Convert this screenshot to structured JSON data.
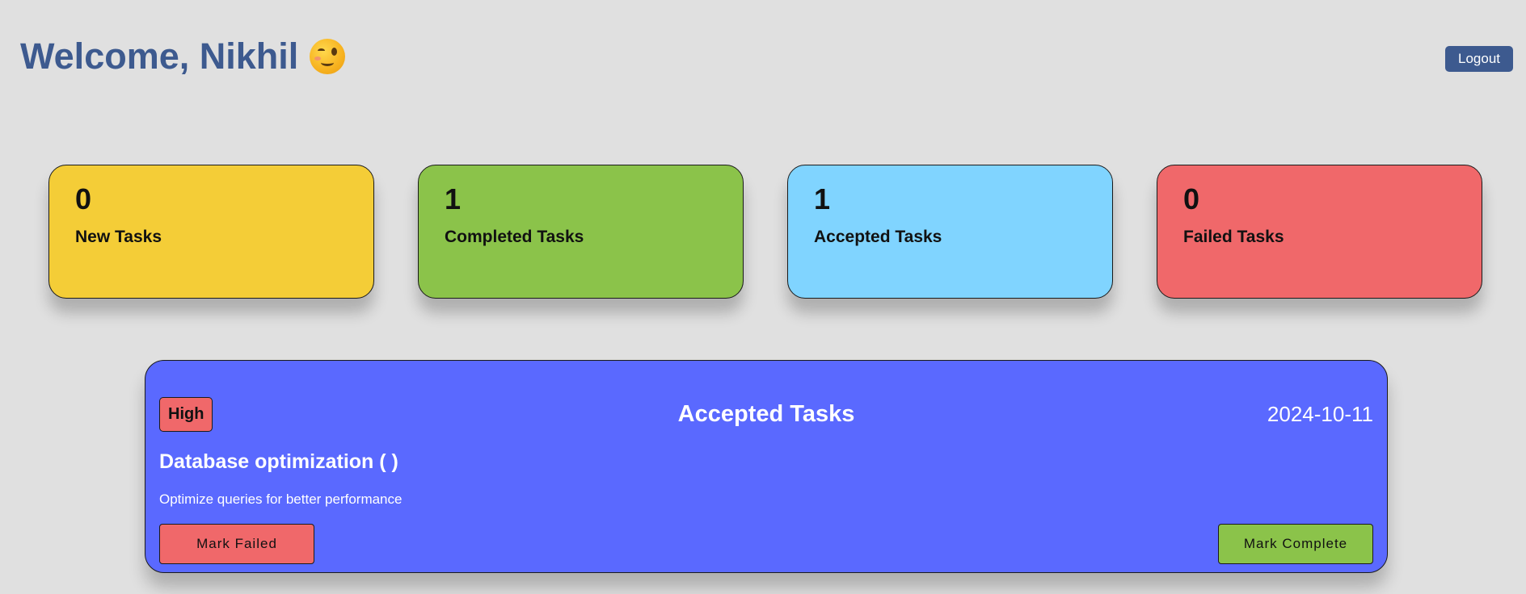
{
  "header": {
    "welcome_text": "Welcome, Nikhil",
    "emoji_icon": "winking-face-icon",
    "logout_label": "Logout"
  },
  "stats": [
    {
      "count": "0",
      "label": "New Tasks",
      "color": "#f4cd37"
    },
    {
      "count": "1",
      "label": "Completed Tasks",
      "color": "#8bc34a"
    },
    {
      "count": "1",
      "label": "Accepted Tasks",
      "color": "#80d4ff"
    },
    {
      "count": "0",
      "label": "Failed Tasks",
      "color": "#f0686a"
    }
  ],
  "task": {
    "priority": "High",
    "heading": "Accepted Tasks",
    "date": "2024-10-11",
    "title": "Database optimization ( )",
    "description": "Optimize queries for better performance",
    "fail_label": "Mark Failed",
    "complete_label": "Mark Complete",
    "card_color": "#5a69ff",
    "priority_color": "#f0686a",
    "fail_color": "#f0686a",
    "complete_color": "#8bc34a"
  },
  "colors": {
    "background": "#e0e0e0",
    "accent": "#3d5a8f"
  }
}
